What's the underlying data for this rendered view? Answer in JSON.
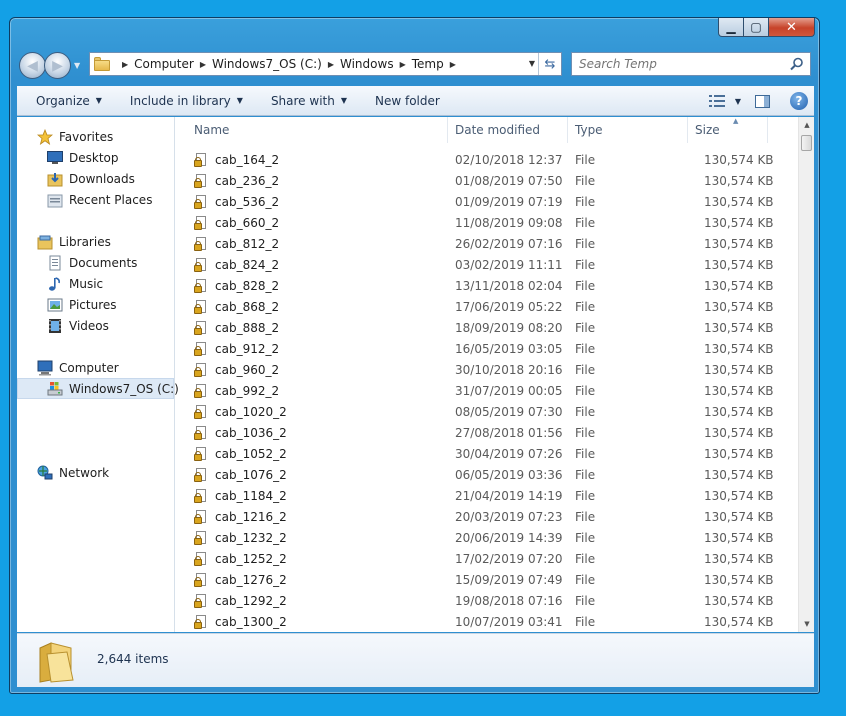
{
  "window": {
    "caption": {
      "minimize": "▁",
      "maximize": "▢",
      "close": "✕"
    }
  },
  "address": {
    "breadcrumbs": [
      "Computer",
      "Windows7_OS (C:)",
      "Windows",
      "Temp"
    ]
  },
  "search": {
    "placeholder": "Search Temp"
  },
  "toolbar": {
    "organize": "Organize",
    "include_in_library": "Include in library",
    "share_with": "Share with",
    "new_folder": "New folder",
    "help": "?"
  },
  "sidebar": {
    "favorites": "Favorites",
    "desktop": "Desktop",
    "downloads": "Downloads",
    "recent_places": "Recent Places",
    "libraries": "Libraries",
    "documents": "Documents",
    "music": "Music",
    "pictures": "Pictures",
    "videos": "Videos",
    "computer": "Computer",
    "drive": "Windows7_OS (C:)",
    "network": "Network"
  },
  "columns": {
    "name": "Name",
    "date": "Date modified",
    "type": "Type",
    "size": "Size"
  },
  "files": [
    {
      "name": "cab_164_2",
      "date": "02/10/2018 12:37",
      "type": "File",
      "size": "130,574 KB"
    },
    {
      "name": "cab_236_2",
      "date": "01/08/2019 07:50",
      "type": "File",
      "size": "130,574 KB"
    },
    {
      "name": "cab_536_2",
      "date": "01/09/2019 07:19",
      "type": "File",
      "size": "130,574 KB"
    },
    {
      "name": "cab_660_2",
      "date": "11/08/2019 09:08",
      "type": "File",
      "size": "130,574 KB"
    },
    {
      "name": "cab_812_2",
      "date": "26/02/2019 07:16",
      "type": "File",
      "size": "130,574 KB"
    },
    {
      "name": "cab_824_2",
      "date": "03/02/2019 11:11",
      "type": "File",
      "size": "130,574 KB"
    },
    {
      "name": "cab_828_2",
      "date": "13/11/2018 02:04",
      "type": "File",
      "size": "130,574 KB"
    },
    {
      "name": "cab_868_2",
      "date": "17/06/2019 05:22",
      "type": "File",
      "size": "130,574 KB"
    },
    {
      "name": "cab_888_2",
      "date": "18/09/2019 08:20",
      "type": "File",
      "size": "130,574 KB"
    },
    {
      "name": "cab_912_2",
      "date": "16/05/2019 03:05",
      "type": "File",
      "size": "130,574 KB"
    },
    {
      "name": "cab_960_2",
      "date": "30/10/2018 20:16",
      "type": "File",
      "size": "130,574 KB"
    },
    {
      "name": "cab_992_2",
      "date": "31/07/2019 00:05",
      "type": "File",
      "size": "130,574 KB"
    },
    {
      "name": "cab_1020_2",
      "date": "08/05/2019 07:30",
      "type": "File",
      "size": "130,574 KB"
    },
    {
      "name": "cab_1036_2",
      "date": "27/08/2018 01:56",
      "type": "File",
      "size": "130,574 KB"
    },
    {
      "name": "cab_1052_2",
      "date": "30/04/2019 07:26",
      "type": "File",
      "size": "130,574 KB"
    },
    {
      "name": "cab_1076_2",
      "date": "06/05/2019 03:36",
      "type": "File",
      "size": "130,574 KB"
    },
    {
      "name": "cab_1184_2",
      "date": "21/04/2019 14:19",
      "type": "File",
      "size": "130,574 KB"
    },
    {
      "name": "cab_1216_2",
      "date": "20/03/2019 07:23",
      "type": "File",
      "size": "130,574 KB"
    },
    {
      "name": "cab_1232_2",
      "date": "20/06/2019 14:39",
      "type": "File",
      "size": "130,574 KB"
    },
    {
      "name": "cab_1252_2",
      "date": "17/02/2019 07:20",
      "type": "File",
      "size": "130,574 KB"
    },
    {
      "name": "cab_1276_2",
      "date": "15/09/2019 07:49",
      "type": "File",
      "size": "130,574 KB"
    },
    {
      "name": "cab_1292_2",
      "date": "19/08/2018 07:16",
      "type": "File",
      "size": "130,574 KB"
    },
    {
      "name": "cab_1300_2",
      "date": "10/07/2019 03:41",
      "type": "File",
      "size": "130,574 KB"
    }
  ],
  "status": {
    "item_count": "2,644 items"
  }
}
